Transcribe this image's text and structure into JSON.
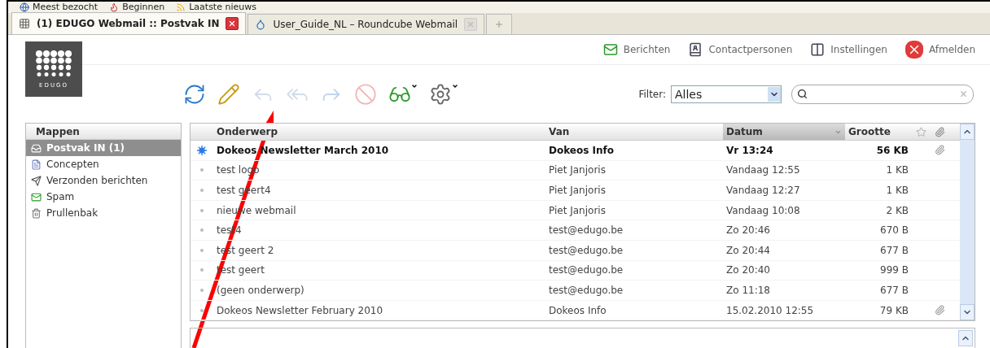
{
  "bookmarks": [
    {
      "label": "Meest bezocht",
      "kind": "globe"
    },
    {
      "label": "Beginnen",
      "kind": "flame"
    },
    {
      "label": "Laatste nieuws",
      "kind": "rss"
    }
  ],
  "tabs": [
    {
      "title": "(1) EDUGO Webmail :: Postvak IN",
      "selected": true,
      "kind": "grid"
    },
    {
      "title": "User_Guide_NL – Roundcube Webmail",
      "selected": false,
      "kind": "drop"
    }
  ],
  "logo": {
    "text": "EDUGO"
  },
  "nav": [
    {
      "label": "Berichten",
      "kind": "mail"
    },
    {
      "label": "Contactpersonen",
      "kind": "contacts"
    },
    {
      "label": "Instellingen",
      "kind": "settings"
    },
    {
      "label": "Afmelden",
      "kind": "logout"
    }
  ],
  "toolbar": [
    {
      "kind": "refresh",
      "disabled": false
    },
    {
      "kind": "compose",
      "disabled": false
    },
    {
      "kind": "reply",
      "disabled": true
    },
    {
      "kind": "replyall",
      "disabled": true
    },
    {
      "kind": "forward",
      "disabled": true
    },
    {
      "kind": "delete",
      "disabled": true
    },
    {
      "kind": "mark",
      "disabled": false
    },
    {
      "kind": "more",
      "disabled": false
    }
  ],
  "filter": {
    "label": "Filter:",
    "value": "Alles"
  },
  "folders": {
    "title": "Mappen",
    "items": [
      {
        "label": "Postvak IN (1)",
        "kind": "inbox",
        "selected": true
      },
      {
        "label": "Concepten",
        "kind": "drafts",
        "selected": false
      },
      {
        "label": "Verzonden berichten",
        "kind": "sent",
        "selected": false
      },
      {
        "label": "Spam",
        "kind": "spam",
        "selected": false
      },
      {
        "label": "Prullenbak",
        "kind": "trash",
        "selected": false
      }
    ]
  },
  "columns": [
    {
      "label": "Onderwerp",
      "sorted": false
    },
    {
      "label": "Van",
      "sorted": false
    },
    {
      "label": "Datum",
      "sorted": true
    },
    {
      "label": "Grootte",
      "sorted": false
    }
  ],
  "messages": [
    {
      "subject": "Dokeos Newsletter March 2010",
      "from": "Dokeos Info",
      "date": "Vr 13:24",
      "size": "56 KB",
      "unread": true,
      "attachment": true
    },
    {
      "subject": "test logo",
      "from": "Piet Janjoris",
      "date": "Vandaag 12:55",
      "size": "1 KB",
      "unread": false,
      "attachment": false
    },
    {
      "subject": "test geert4",
      "from": "Piet Janjoris",
      "date": "Vandaag 12:27",
      "size": "1 KB",
      "unread": false,
      "attachment": false
    },
    {
      "subject": "nieuwe webmail",
      "from": "Piet Janjoris",
      "date": "Vandaag 10:08",
      "size": "2 KB",
      "unread": false,
      "attachment": false
    },
    {
      "subject": "test4",
      "from": "test@edugo.be",
      "date": "Zo 20:46",
      "size": "670 B",
      "unread": false,
      "attachment": false
    },
    {
      "subject": "test geert 2",
      "from": "test@edugo.be",
      "date": "Zo 20:44",
      "size": "677 B",
      "unread": false,
      "attachment": false
    },
    {
      "subject": "test geert",
      "from": "test@edugo.be",
      "date": "Zo 20:40",
      "size": "999 B",
      "unread": false,
      "attachment": false
    },
    {
      "subject": "(geen onderwerp)",
      "from": "test@edugo.be",
      "date": "Zo 11:18",
      "size": "677 B",
      "unread": false,
      "attachment": false
    },
    {
      "subject": "Dokeos Newsletter February 2010",
      "from": "Dokeos Info",
      "date": "15.02.2010 12:55",
      "size": "79 KB",
      "unread": false,
      "attachment": true
    }
  ]
}
